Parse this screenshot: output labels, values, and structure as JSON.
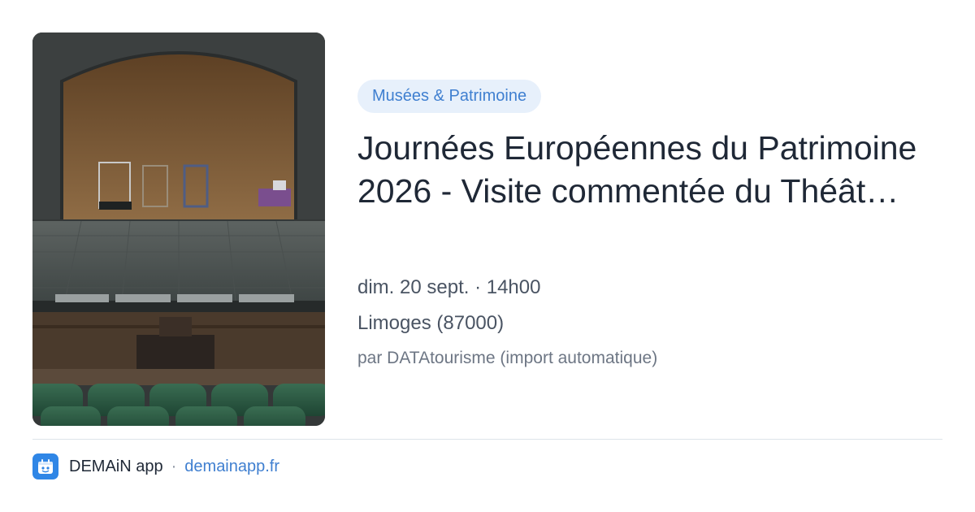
{
  "card": {
    "image_alt": "Scène de théâtre avec rangées de fauteuils verts",
    "category_badge": "Musées & Patrimoine",
    "title": "Journées Européennes du Patrimoine 2026 - Visite commentée du Théât…",
    "date_time": "dim. 20 sept. · 14h00",
    "location": "Limoges (87000)",
    "source": "par DATAtourisme (import automatique)"
  },
  "footer": {
    "app_icon": "app-logo-icon",
    "app_name": "DEMAiN app",
    "separator": "·",
    "domain": "demainapp.fr"
  },
  "colors": {
    "accent": "#3f7fd0",
    "badge_bg": "#e7f0fb",
    "title": "#1f2836",
    "meta": "#4a5463",
    "app_icon_bg": "#2f86e6"
  }
}
